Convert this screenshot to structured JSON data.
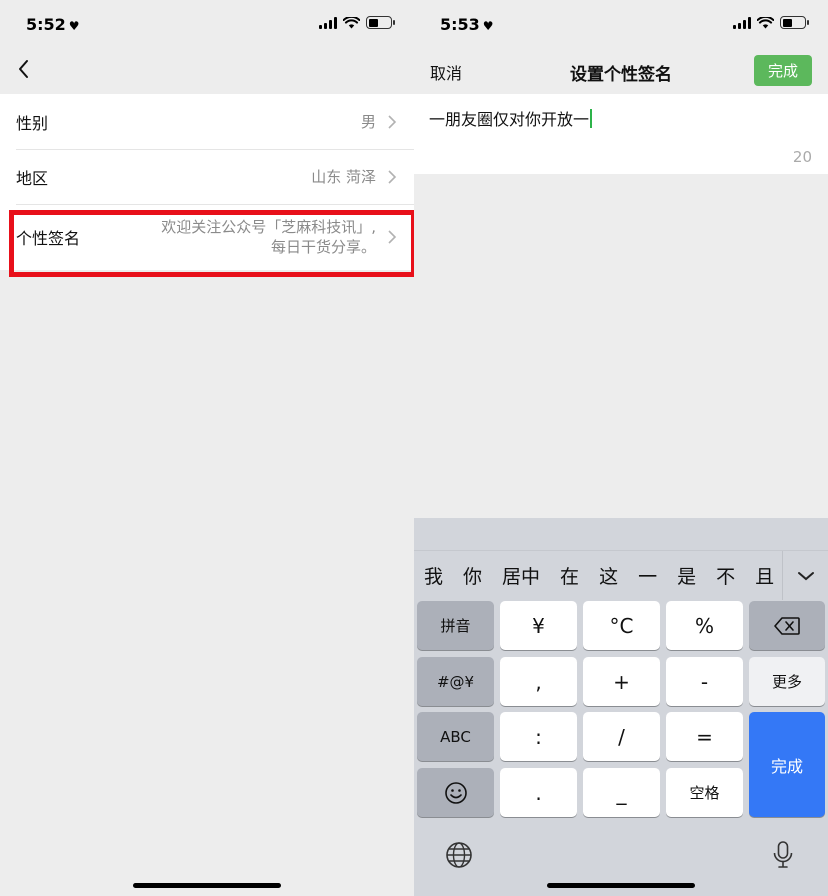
{
  "left_screen": {
    "status": {
      "time": "5:52",
      "heart": "♥"
    },
    "list": [
      {
        "label": "性别",
        "value": "男"
      },
      {
        "label": "地区",
        "value": "山东 菏泽"
      },
      {
        "label": "个性签名",
        "value_line1": "欢迎关注公众号「芝麻科技讯」,",
        "value_line2": "每日干货分享。"
      }
    ]
  },
  "right_screen": {
    "status": {
      "time": "5:53",
      "heart": "♥"
    },
    "nav": {
      "cancel": "取消",
      "title": "设置个性签名",
      "done": "完成"
    },
    "editor": {
      "text": "一朋友圈仅对你开放一",
      "counter": "20"
    },
    "keyboard": {
      "candidates": [
        "我",
        "你",
        "居中",
        "在",
        "这",
        "一",
        "是",
        "不",
        "且"
      ],
      "rows": [
        [
          "拼音",
          "¥",
          "°C",
          "%",
          "delete"
        ],
        [
          "#@¥",
          ",",
          "+",
          "-",
          "更多"
        ],
        [
          "ABC",
          ":",
          "/",
          "=",
          "完成"
        ],
        [
          "emoji",
          ".",
          "_",
          "空格"
        ]
      ]
    }
  },
  "colors": {
    "highlight": "#e8101a",
    "done_green": "#5cb85c",
    "keyboard_blue": "#3478f6",
    "caret": "#2db34a"
  },
  "icons": [
    "back-chevron-icon",
    "chevron-right-icon",
    "heart-icon",
    "signal-icon",
    "wifi-icon",
    "battery-icon",
    "chevron-down-icon",
    "delete-icon",
    "emoji-icon",
    "globe-icon",
    "microphone-icon"
  ]
}
